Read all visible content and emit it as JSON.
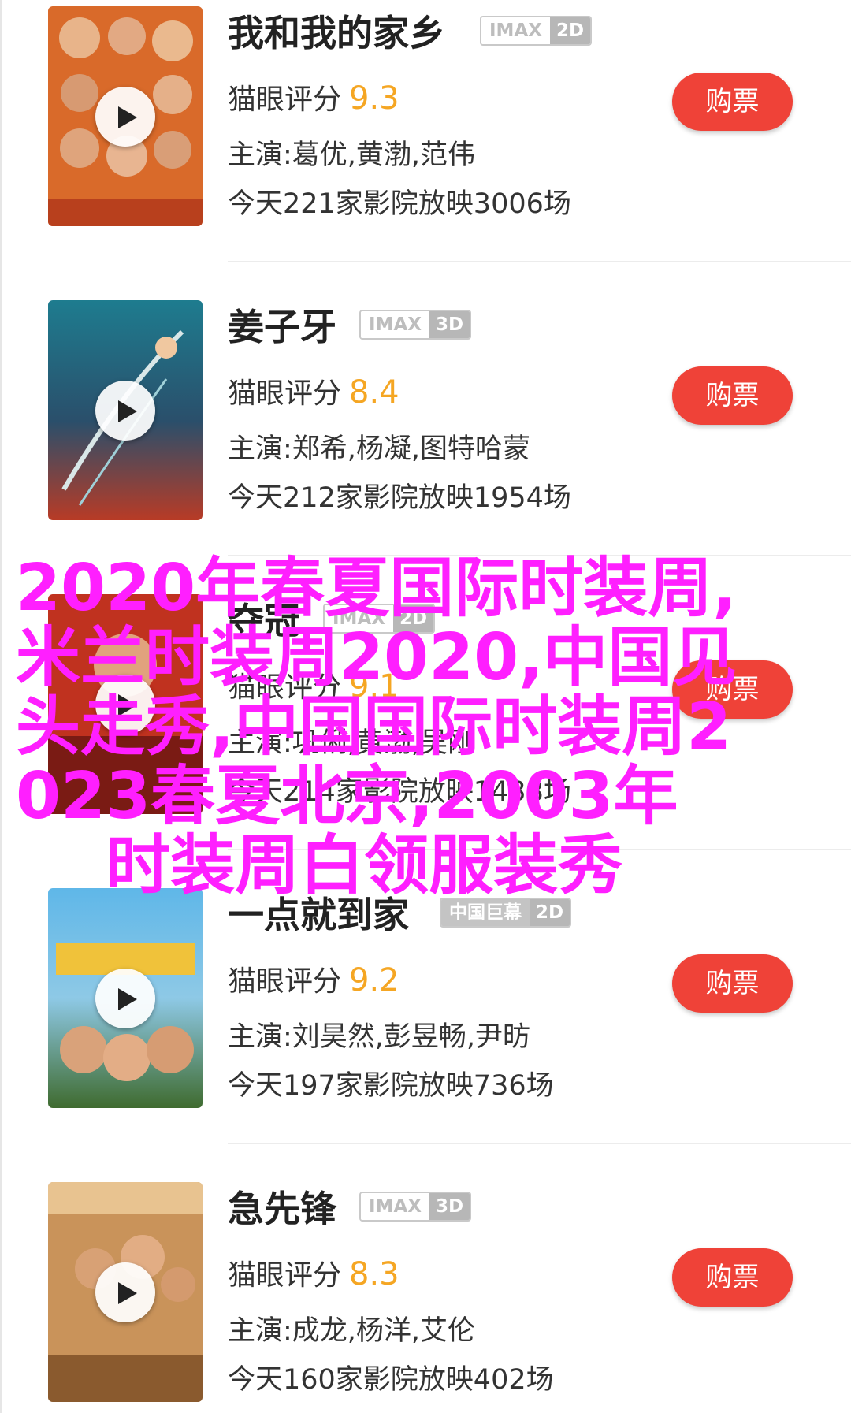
{
  "movies": [
    {
      "title": "我和我的家乡",
      "badge_left": "IMAX",
      "badge_right": "2D",
      "rating_label": "猫眼评分",
      "score": "9.3",
      "cast": "主演:葛优,黄渤,范伟",
      "showing": "今天221家影院放映3006场",
      "buy_label": "购票"
    },
    {
      "title": "姜子牙",
      "badge_left": "IMAX",
      "badge_right": "3D",
      "rating_label": "猫眼评分",
      "score": "8.4",
      "cast": "主演:郑希,杨凝,图特哈蒙",
      "showing": "今天212家影院放映1954场",
      "buy_label": "购票"
    },
    {
      "title": "夺冠",
      "badge_left": "IMAX",
      "badge_right": "2D",
      "rating_label": "猫眼评分",
      "score": "9.1",
      "cast": "主演:巩俐,黄渤,吴刚",
      "showing": "今天214家影院放映1438场",
      "buy_label": "购票"
    },
    {
      "title": "一点就到家",
      "badge_left": "中国巨幕",
      "badge_right": "2D",
      "rating_label": "猫眼评分",
      "score": "9.2",
      "cast": "主演:刘昊然,彭昱畅,尹昉",
      "showing": "今天197家影院放映736场",
      "buy_label": "购票"
    },
    {
      "title": "急先锋",
      "badge_left": "IMAX",
      "badge_right": "3D",
      "rating_label": "猫眼评分",
      "score": "8.3",
      "cast": "主演:成龙,杨洋,艾伦",
      "showing": "今天160家影院放映402场",
      "buy_label": "购票"
    }
  ],
  "watermark_lines": [
    "2020年春夏国际时装周,",
    "米兰时装周2020,中国见",
    " 头走秀,中国国际时装周2",
    "023春夏北京,2003年",
    "    时装周白领服装秀"
  ],
  "colors": {
    "buy_button": "#ef4238",
    "score": "#f5a623",
    "watermark": "#ff1fff"
  }
}
